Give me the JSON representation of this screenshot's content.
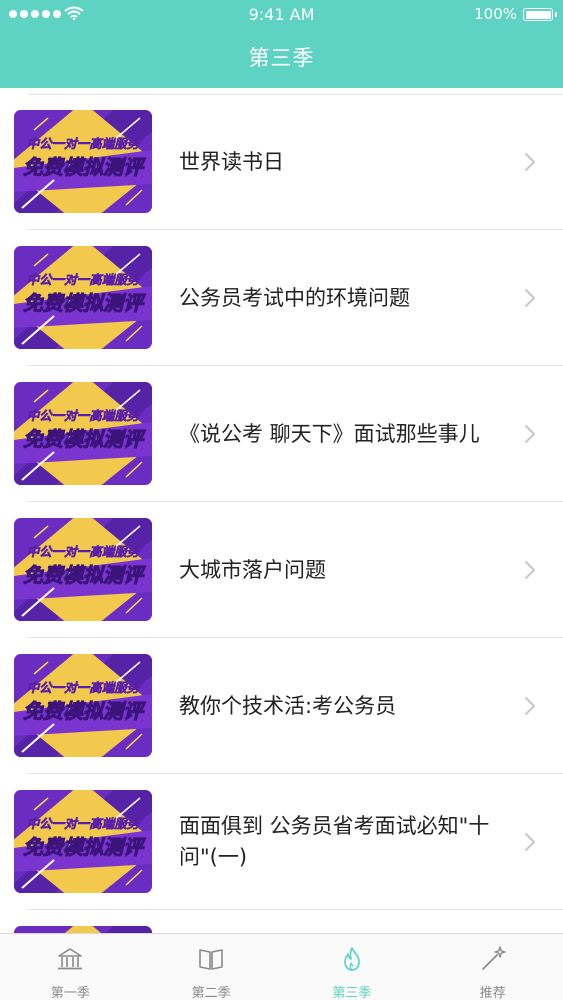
{
  "status_bar": {
    "time": "9:41 AM",
    "battery": "100%"
  },
  "nav": {
    "title": "第三季"
  },
  "thumbnail": {
    "line1": "中公一对一高端服务",
    "line2": "免费模拟测评"
  },
  "list": [
    {
      "title": "世界读书日"
    },
    {
      "title": "公务员考试中的环境问题"
    },
    {
      "title": "《说公考 聊天下》面试那些事儿"
    },
    {
      "title": "大城市落户问题"
    },
    {
      "title": "教你个技术活:考公务员"
    },
    {
      "title": "面面俱到 公务员省考面试必知\"十问\"(一)"
    },
    {
      "title": ""
    }
  ],
  "tabs": [
    {
      "label": "第一季",
      "icon": "temple-icon",
      "active": false
    },
    {
      "label": "第二季",
      "icon": "book-icon",
      "active": false
    },
    {
      "label": "第三季",
      "icon": "flame-icon",
      "active": true
    },
    {
      "label": "推荐",
      "icon": "magic-wand-icon",
      "active": false
    }
  ],
  "colors": {
    "accent": "#5fd3c3",
    "thumb_purple": "#6b2cc1",
    "thumb_yellow": "#f2c94c"
  }
}
